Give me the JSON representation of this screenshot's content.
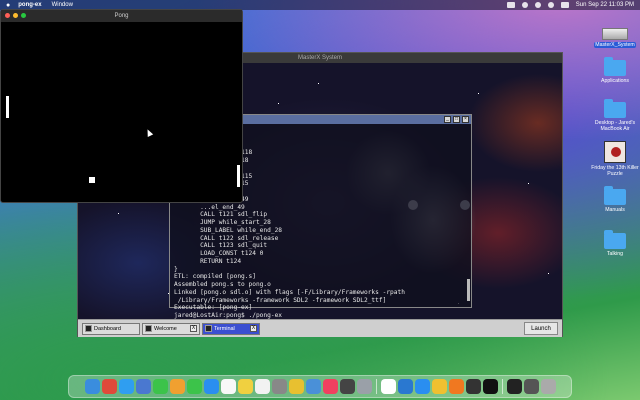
{
  "menubar": {
    "apple": "",
    "app_name": "pong-ex",
    "menus": [
      "Window"
    ],
    "datetime": "Sun Sep 22  11:03 PM"
  },
  "pong_window": {
    "title": "Pong"
  },
  "masterx_window": {
    "title": "MasterX System"
  },
  "terminal": {
    "lines": [
      "       ..._y t119",
      "       ...20",
      "       ..._118",
      "       ...el_else_118",
      "       ...el_end_118",
      "       ..._115",
      "       ...el_else_115",
      "       ...el_end_115",
      "       ..._49",
      "       ...el_else_49",
      "       ...el_end_49",
      "       CALL t121 sdl_flip",
      "       JUMP while_start_28",
      "       SUB_LABEL while_end_28",
      "       CALL t122 sdl_release",
      "       CALL t123 sdl_quit",
      "       LOAD_CONST t124 0",
      "       RETURN t124",
      "}",
      "ETL: compiled [pong.s]",
      "Assembled pong.s to pong.o",
      "Linked [pong.o sdl.o] with flags [-F/Library/Frameworks -rpath",
      " /Library/Frameworks -framework SDL2 -framework SDL2_ttf]",
      "Executable: [pong-ex]",
      "jared@LostAir:pong$ ./pong-ex"
    ]
  },
  "taskbar": {
    "tasks": [
      {
        "label": "Dashboard"
      },
      {
        "label": "Welcome",
        "close": "X"
      },
      {
        "label": "Terminal",
        "close": "X"
      }
    ],
    "launch_label": "Launch"
  },
  "desktop_icons": [
    {
      "label": "MasterX_System"
    },
    {
      "label": "Applications"
    },
    {
      "label": "Desktop - Jared's MacBook Air"
    },
    {
      "label": "Friday the 13th Killer Puzzle"
    },
    {
      "label": "Manuals"
    },
    {
      "label": "Talking"
    }
  ],
  "colors": {
    "taskbar_active": "#3b4fd1",
    "folder": "#4aa8f0",
    "terminal_text": "#e8e8e8"
  },
  "dock_apps": [
    "finder-icon",
    "launchpad-icon",
    "safari-icon",
    "mail-icon",
    "messages-icon",
    "photos-icon",
    "facetime-icon",
    "appstore-icon",
    "calendar-icon",
    "notes-icon",
    "reminders-icon",
    "settings-icon",
    "chrome-icon",
    "preview-icon",
    "music-icon",
    "activity-icon",
    "cat-viewer-icon",
    "textedit-icon",
    "vscode-icon",
    "xcode-icon",
    "notes2-icon",
    "vlc-icon",
    "app-icon",
    "x-icon",
    "terminal-icon",
    "console-icon",
    "trash-icon"
  ]
}
